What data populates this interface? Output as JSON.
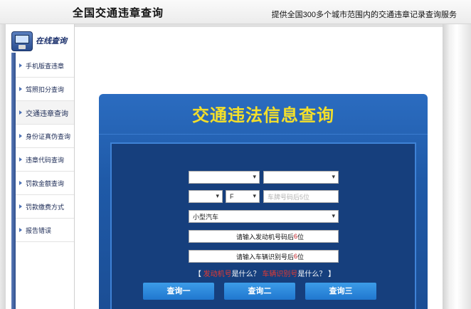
{
  "header": {
    "title": "全国交通违章查询",
    "tagline": "提供全国300多个城市范围内的交通违章记录查询服务"
  },
  "sidebar": {
    "head_label": "在线查询",
    "items": [
      {
        "label": "手机版查违章"
      },
      {
        "label": "驾照扣分查询"
      },
      {
        "label": "交通违章查询"
      },
      {
        "label": "身份证真伪查询"
      },
      {
        "label": "违章代码查询"
      },
      {
        "label": "罚款金额查询"
      },
      {
        "label": "罚款缴费方式"
      },
      {
        "label": "报告错误"
      }
    ]
  },
  "panel": {
    "title": "交通违法信息查询",
    "province_value": "",
    "city_value": "",
    "plate_prefix_value": "",
    "plate_letter_value": "F",
    "plate_number_placeholder": "车牌号码后5位",
    "vehicle_type_value": "小型汽车",
    "engine_prefix": "请输入发动机号码后",
    "engine_digits": "6",
    "engine_suffix": "位",
    "vin_prefix": "请输入车辆识别号后",
    "vin_digits": "6",
    "vin_suffix": "位",
    "links": {
      "open_bracket": "【",
      "link1": "发动机号",
      "text1": "是什么？",
      "link2": "车辆识别号",
      "text2": "是什么？",
      "close_bracket": "】"
    },
    "buttons": [
      "查询一",
      "查询二",
      "查询三"
    ]
  },
  "colors": {
    "panel_blue": "#1f5aa8",
    "title_yellow": "#f4df2a",
    "button_blue": "#2f8ae0",
    "link_red": "#e53a32"
  }
}
